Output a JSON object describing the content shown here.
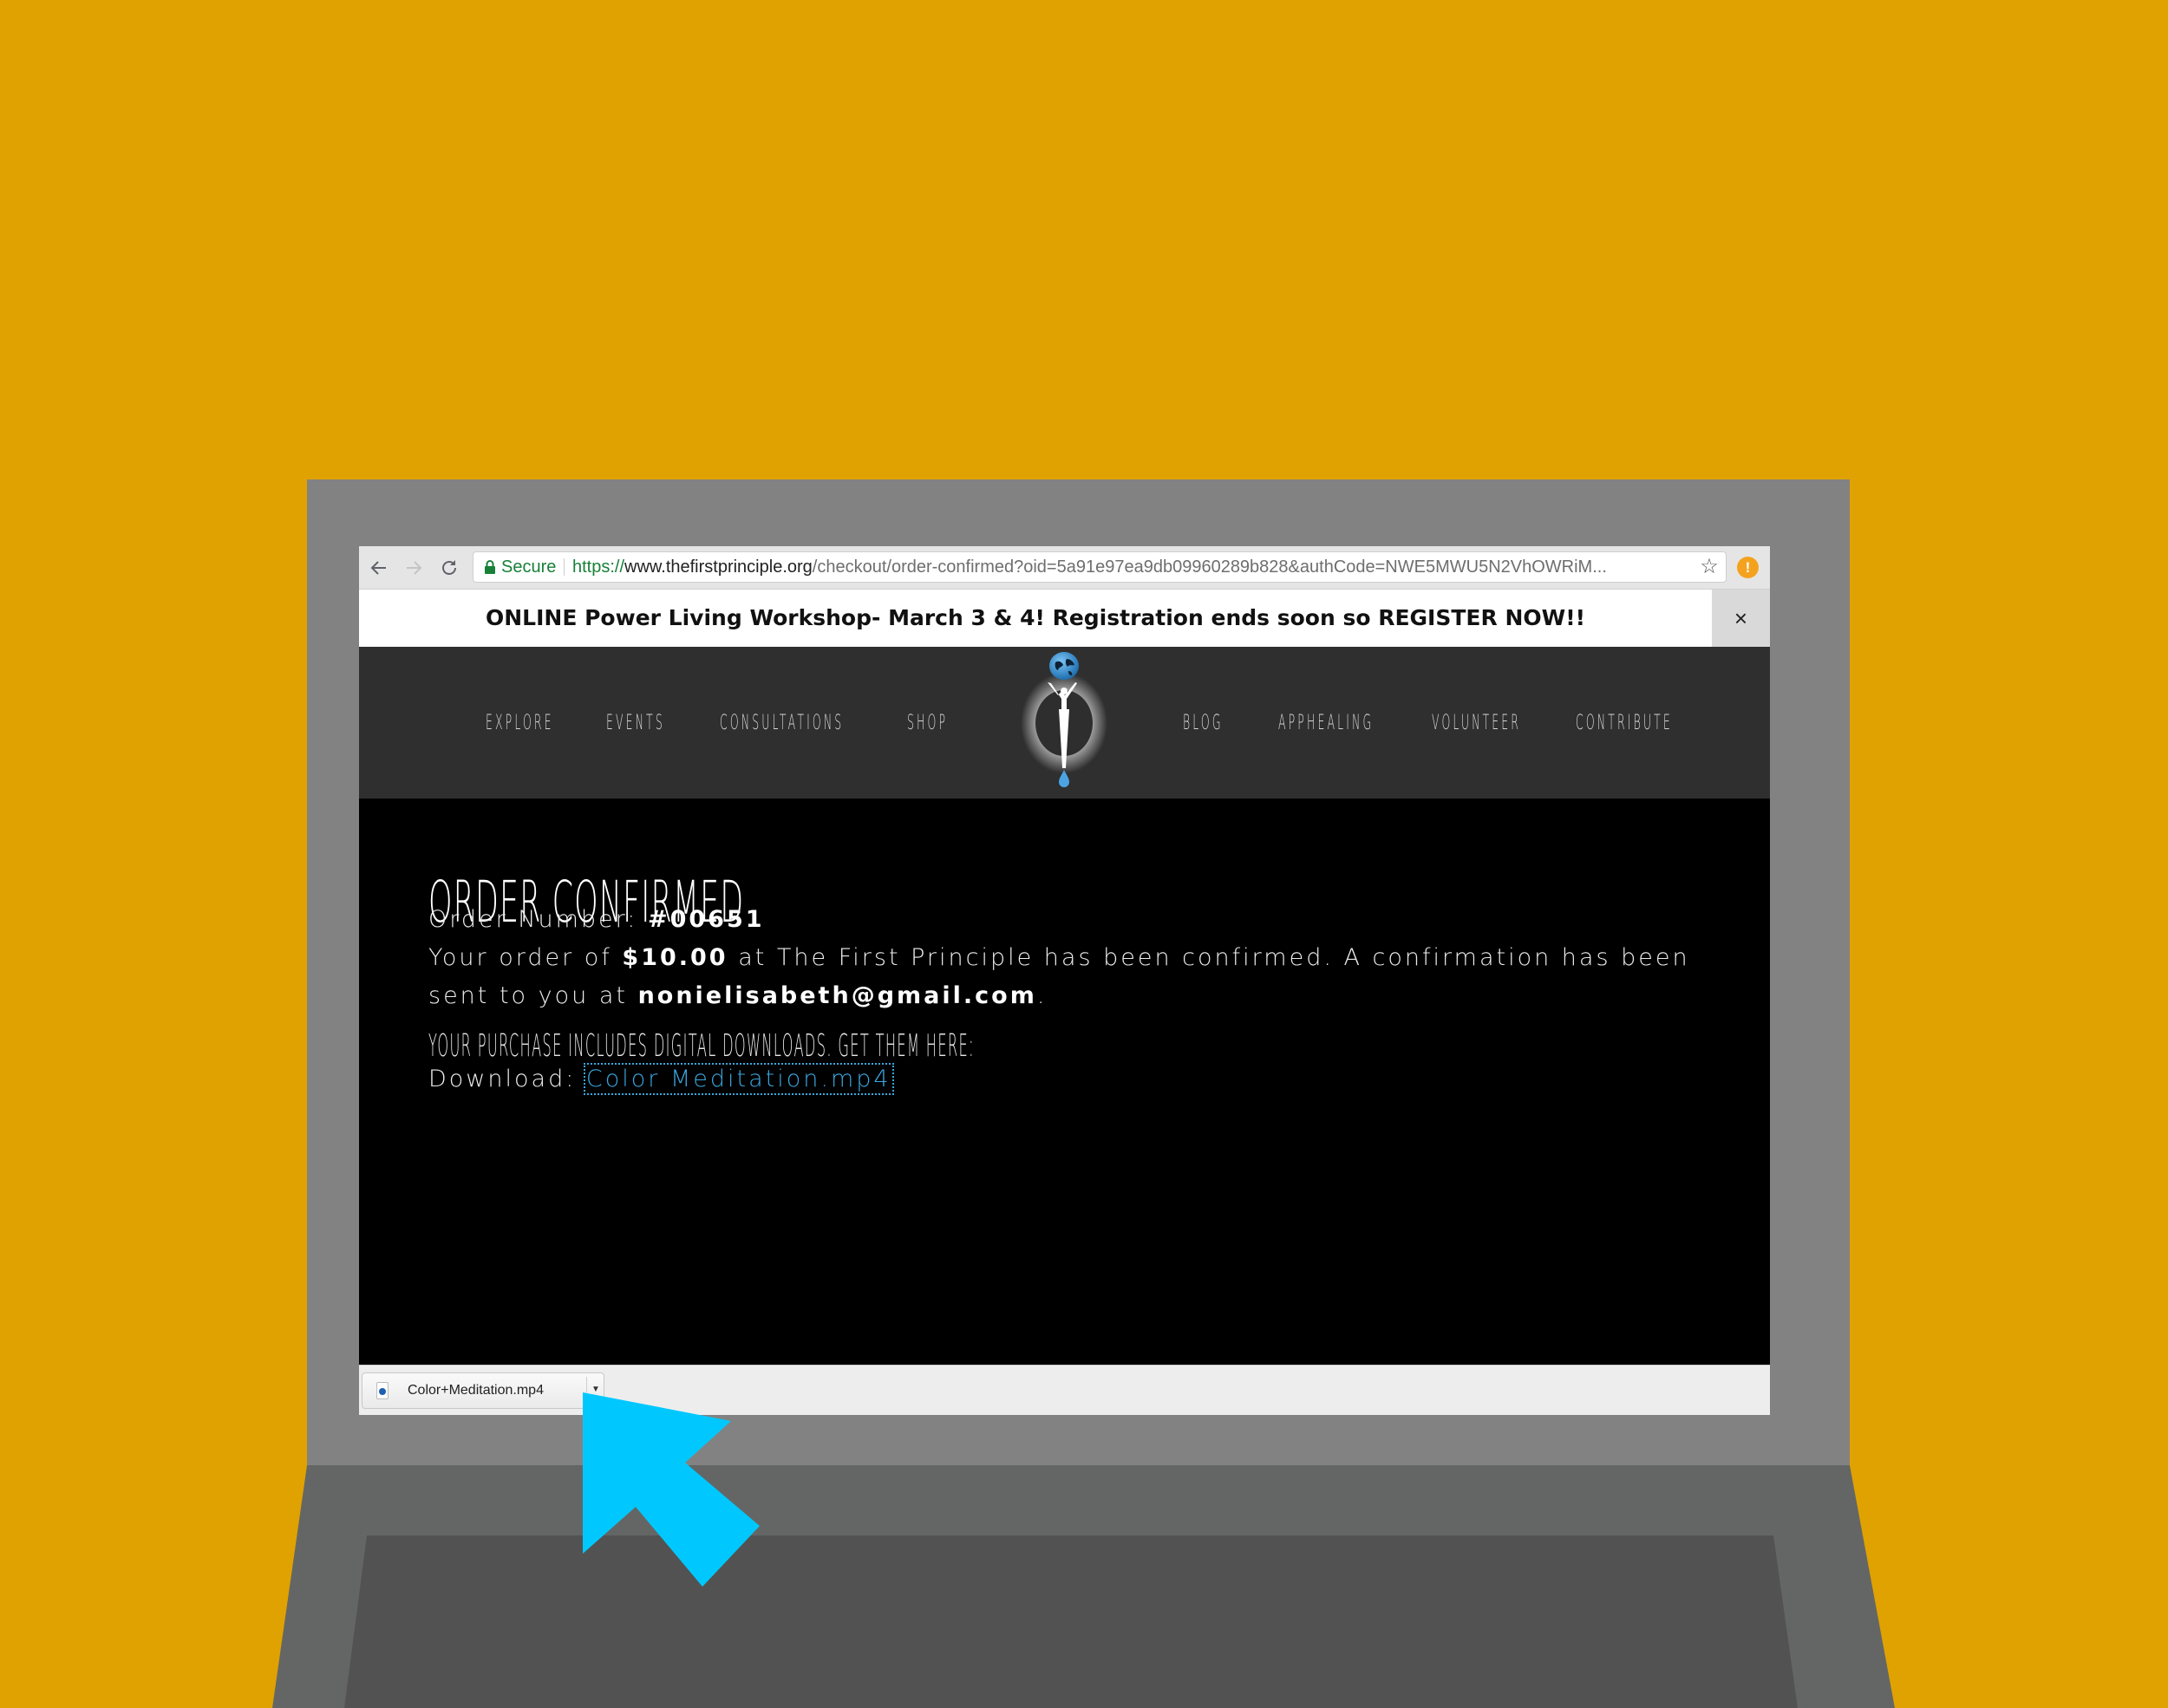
{
  "colors": {
    "background": "#E0A200",
    "bezel": "#828282",
    "base": "#646665",
    "keyboard": "#525252",
    "nav_bg": "#2F2F2F",
    "link": "#3BA7DF",
    "cursor": "#00C8FF",
    "secure_green": "#188038"
  },
  "browser": {
    "icons": {
      "back": "arrow-left-icon",
      "forward": "arrow-right-icon",
      "reload": "reload-icon",
      "lock": "lock-icon",
      "star": "star-icon",
      "extension": "alert-icon"
    },
    "secure_label": "Secure",
    "url_scheme": "https://",
    "url_host": "www.thefirstprinciple.org",
    "url_path": "/checkout/order-confirmed?oid=5a91e97ea9db09960289b828&authCode=NWE5MWU5N2VhOWRiM...",
    "star_glyph": "☆",
    "extension_glyph": "!"
  },
  "banner": {
    "text": "ONLINE Power Living Workshop- March 3 & 4! Registration ends soon so REGISTER NOW!!",
    "close_glyph": "×"
  },
  "nav": {
    "left_items": [
      "EXPLORE",
      "EVENTS",
      "CONSULTATIONS",
      "SHOP"
    ],
    "right_items": [
      "BLOG",
      "APPHEALING",
      "VOLUNTEER",
      "CONTRIBUTE"
    ],
    "logo": "the-first-principle-logo"
  },
  "main": {
    "title": "ORDER CONFIRMED",
    "order_number_label": "Order Number: ",
    "order_number": "#00651",
    "para_prefix": "Your order of ",
    "amount": "$10.00",
    "para_middle": " at The First Principle has been confirmed. A confirmation has been",
    "para_line2_prefix": "sent to you at ",
    "email": "nonielisabeth@gmail.com",
    "para_suffix": ".",
    "downloads_heading": "YOUR PURCHASE INCLUDES DIGITAL DOWNLOADS. GET THEM HERE:",
    "download_label": "Download: ",
    "download_link": "Color Meditation.mp4"
  },
  "download_shelf": {
    "file_name": "Color+Meditation.mp4",
    "caret_glyph": "▼"
  }
}
